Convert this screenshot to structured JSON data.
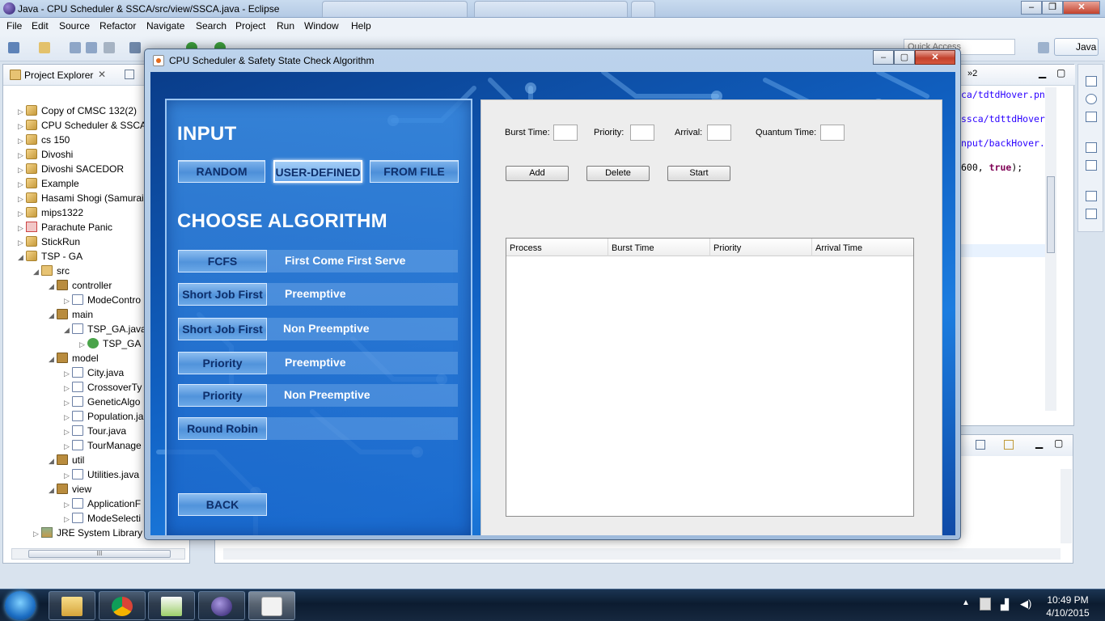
{
  "eclipse": {
    "window_title": "Java - CPU Scheduler & SSCA/src/view/SSCA.java - Eclipse",
    "menu": [
      "File",
      "Edit",
      "Source",
      "Refactor",
      "Navigate",
      "Search",
      "Project",
      "Run",
      "Window",
      "Help"
    ],
    "quick_access_placeholder": "Quick Access",
    "perspective": "Java"
  },
  "project_explorer": {
    "title": "Project Explorer",
    "items": [
      {
        "label": "Copy of CMSC 132(2)",
        "icon": "project-icon"
      },
      {
        "label": "CPU Scheduler & SSCA",
        "icon": "project-icon"
      },
      {
        "label": "cs 150",
        "icon": "project-icon"
      },
      {
        "label": "Divoshi",
        "icon": "project-icon"
      },
      {
        "label": "Divoshi SACEDOR",
        "icon": "project-icon"
      },
      {
        "label": "Example",
        "icon": "project-icon"
      },
      {
        "label": "Hasami Shogi (Samurai",
        "icon": "project-icon"
      },
      {
        "label": "mips1322",
        "icon": "project-icon"
      },
      {
        "label": "Parachute Panic",
        "icon": "project-error-icon"
      },
      {
        "label": "StickRun",
        "icon": "project-icon"
      },
      {
        "label": "TSP - GA",
        "icon": "project-icon"
      },
      {
        "label": "src",
        "icon": "source-folder-icon"
      },
      {
        "label": "controller",
        "icon": "package-icon"
      },
      {
        "label": "ModeContro",
        "icon": "java-file-icon"
      },
      {
        "label": "main",
        "icon": "package-icon"
      },
      {
        "label": "TSP_GA.java",
        "icon": "java-file-icon"
      },
      {
        "label": "TSP_GA",
        "icon": "class-icon"
      },
      {
        "label": "model",
        "icon": "package-icon"
      },
      {
        "label": "City.java",
        "icon": "java-file-icon"
      },
      {
        "label": "CrossoverTy",
        "icon": "java-file-icon"
      },
      {
        "label": "GeneticAlgo",
        "icon": "java-file-icon"
      },
      {
        "label": "Population.ja",
        "icon": "java-file-icon"
      },
      {
        "label": "Tour.java",
        "icon": "java-file-icon"
      },
      {
        "label": "TourManage",
        "icon": "java-file-icon"
      },
      {
        "label": "util",
        "icon": "package-icon"
      },
      {
        "label": "Utilities.java",
        "icon": "java-file-icon"
      },
      {
        "label": "view",
        "icon": "package-icon"
      },
      {
        "label": "ApplicationF",
        "icon": "java-file-icon"
      },
      {
        "label": "ModeSelecti",
        "icon": "java-file-icon"
      },
      {
        "label": "JRE System Library [",
        "icon": "library-icon"
      }
    ],
    "scroll_thumb": "III"
  },
  "editor": {
    "tab_overflow": "»2",
    "lines": [
      {
        "text": "ca/tdtdHover.pn",
        "kind": "string"
      },
      {
        "text": "ssca/tdttdHover",
        "kind": "string"
      },
      {
        "text": "nput/backHover.",
        "kind": "string"
      },
      {
        "text": "600, ",
        "kind": "plain",
        "suffix": "true",
        "end": ");"
      }
    ]
  },
  "app": {
    "window_title": "CPU Scheduler & Safety State Check Algorithm",
    "input_heading": "INPUT",
    "input_modes": [
      "RANDOM",
      "USER-DEFINED",
      "FROM FILE"
    ],
    "selected_mode": "USER-DEFINED",
    "algorithm_heading": "CHOOSE ALGORITHM",
    "algorithms": [
      {
        "button": "FCFS",
        "desc": "First Come First Serve"
      },
      {
        "button": "Short Job First",
        "desc": "Preemptive"
      },
      {
        "button": "Short Job First",
        "desc": "Non Preemptive"
      },
      {
        "button": "Priority",
        "desc": "Preemptive"
      },
      {
        "button": "Priority",
        "desc": "Non Preemptive"
      },
      {
        "button": "Round Robin",
        "desc": ""
      }
    ],
    "back": "BACK",
    "fields": {
      "burst_time": {
        "label": "Burst Time:",
        "value": ""
      },
      "priority": {
        "label": "Priority:",
        "value": ""
      },
      "arrival": {
        "label": "Arrival:",
        "value": ""
      },
      "quantum_time": {
        "label": "Quantum Time:",
        "value": ""
      }
    },
    "actions": {
      "add": "Add",
      "delete": "Delete",
      "start": "Start"
    },
    "table": {
      "columns": [
        "Process",
        "Burst Time",
        "Priority",
        "Arrival Time"
      ],
      "rows": []
    }
  },
  "taskbar": {
    "apps": [
      "file-explorer-icon",
      "chrome-icon",
      "notepad-plus-icon",
      "eclipse-icon",
      "java-icon"
    ],
    "time": "10:49 PM",
    "date": "4/10/2015"
  },
  "colors": {
    "app_background": "#1162c4",
    "panel_border": "#9cc6f3",
    "button_text": "#0e2f6b"
  }
}
